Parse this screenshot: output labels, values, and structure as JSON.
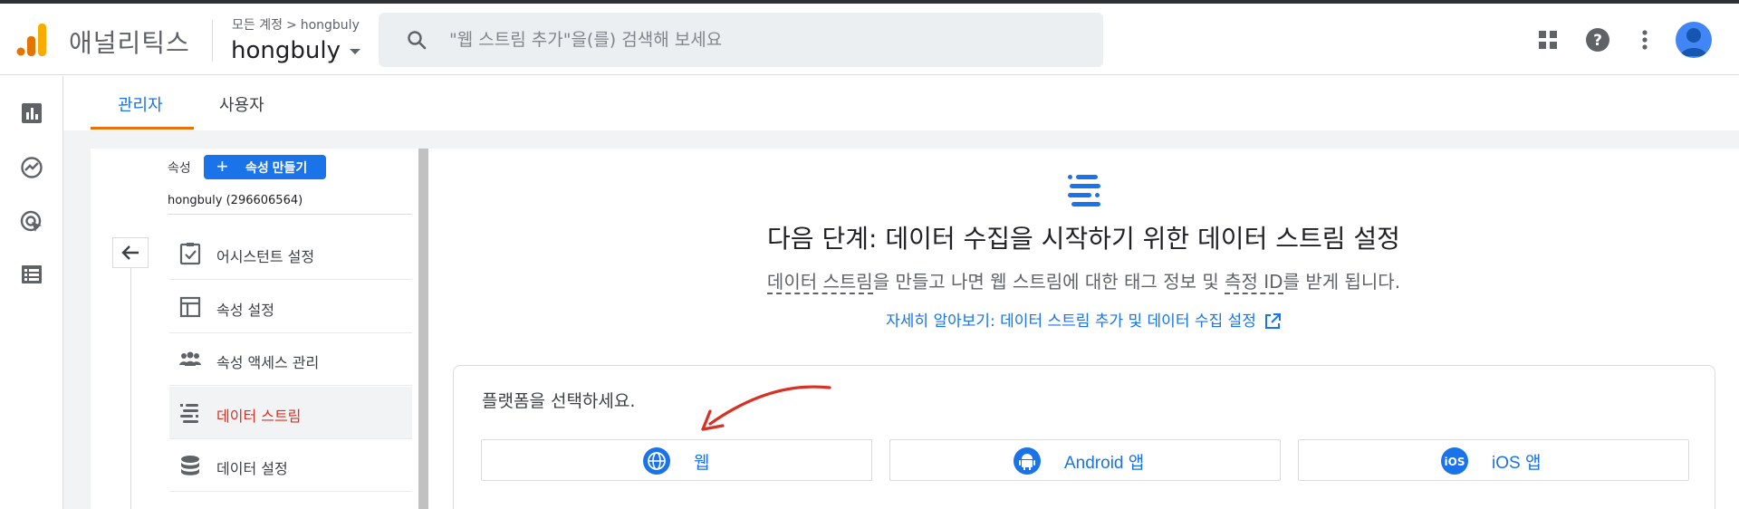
{
  "header": {
    "app_name": "애널리틱스",
    "breadcrumb_root": "모든 계정",
    "breadcrumb_sep": ">",
    "breadcrumb_account": "hongbuly",
    "account_name": "hongbuly",
    "search_placeholder": "\"웹 스트림 추가\"을(를) 검색해 보세요"
  },
  "tabs": [
    {
      "label": "관리자",
      "active": true
    },
    {
      "label": "사용자",
      "active": false
    }
  ],
  "property": {
    "label": "속성",
    "create_button": "속성 만들기",
    "name": "hongbuly (296606564)"
  },
  "menu": [
    {
      "label": "어시스턴트 설정",
      "icon": "checklist-icon",
      "active": false
    },
    {
      "label": "속성 설정",
      "icon": "layout-icon",
      "active": false
    },
    {
      "label": "속성 액세스 관리",
      "icon": "people-icon",
      "active": false
    },
    {
      "label": "데이터 스트림",
      "icon": "data-stream-icon",
      "active": true
    },
    {
      "label": "데이터 설정",
      "icon": "database-icon",
      "active": false
    }
  ],
  "main": {
    "title": "다음 단계: 데이터 수집을 시작하기 위한 데이터 스트림 설정",
    "desc_part1": "데이터 스트림",
    "desc_part2": "을 만들고 나면 웹 스트림에 대한 태그 정보 및 ",
    "desc_part3": "측정 ID",
    "desc_part4": "를 받게 됩니다.",
    "learn_more": "자세히 알아보기: 데이터 스트림 추가 및 데이터 수집 설정",
    "platform_label": "플랫폼을 선택하세요.",
    "platforms": [
      {
        "label": "웹",
        "icon": "globe-icon"
      },
      {
        "label": "Android 앱",
        "icon": "android-icon"
      },
      {
        "label": "iOS 앱",
        "icon": "ios-icon"
      }
    ]
  },
  "colors": {
    "accent": "#1a73e8",
    "tab_underline": "#e8710a",
    "active_menu_text": "#d93025",
    "annotation_arrow": "#d93025"
  }
}
